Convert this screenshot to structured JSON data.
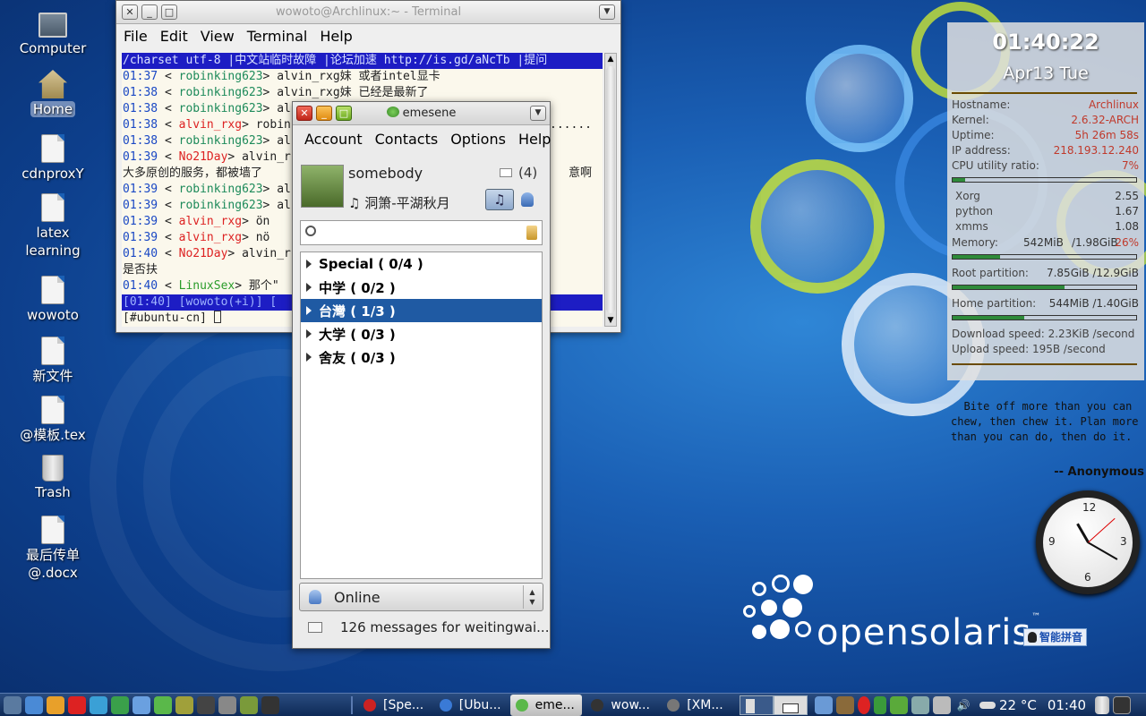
{
  "desktop": {
    "icons": [
      {
        "label": "Computer",
        "icon": "computer-icon"
      },
      {
        "label": "Home",
        "icon": "home-folder-icon"
      },
      {
        "label": "cdnproxY",
        "icon": "folder-icon"
      },
      {
        "label": "latex learning",
        "icon": "folder-icon"
      },
      {
        "label": "wowoto",
        "icon": "folder-icon"
      },
      {
        "label": "新文件",
        "icon": "text-file-icon"
      },
      {
        "label": "@模板.tex",
        "icon": "tex-file-icon"
      },
      {
        "label": "Trash",
        "icon": "trash-icon"
      },
      {
        "label": "最后传单@.docx",
        "icon": "docx-file-icon"
      }
    ]
  },
  "terminal": {
    "title": "wowoto@Archlinux:~ - Terminal",
    "menu": [
      "File",
      "Edit",
      "View",
      "Terminal",
      "Help"
    ],
    "topic": " /charset utf-8 |中文站临时故障 |论坛加速 http://is.gd/aNcTb |提问",
    "lines": [
      {
        "time": "01:37",
        "nick": "robinking623",
        "msg": "alvin_rxg妹 或者intel显卡",
        "color": "n1"
      },
      {
        "time": "01:38",
        "nick": "robinking623",
        "msg": "alvin_rxg妹 已经是最新了",
        "color": "n1"
      },
      {
        "time": "01:38",
        "nick": "robinking623",
        "msg": "al",
        "color": "n1"
      },
      {
        "time": "01:38",
        "nick": "alvin_rxg",
        "msg": "robin",
        "color": "n2",
        "tail": "了......"
      },
      {
        "time": "01:38",
        "nick": "robinking623",
        "msg": "al",
        "color": "n1"
      },
      {
        "time": "01:39",
        "nick": "No21Day",
        "msg": "alvin_r",
        "color": "n2"
      },
      {
        "time": "",
        "nick": "",
        "msg": "大多原创的服务，都被墙了",
        "color": "",
        "tail": "意啊"
      },
      {
        "time": "01:39",
        "nick": "robinking623",
        "msg": "al",
        "color": "n1"
      },
      {
        "time": "01:39",
        "nick": "robinking623",
        "msg": "al",
        "color": "n1"
      },
      {
        "time": "01:39",
        "nick": "alvin_rxg",
        "msg": "ön",
        "color": "n2"
      },
      {
        "time": "01:39",
        "nick": "alvin_rxg",
        "msg": "nö",
        "color": "n2"
      },
      {
        "time": "01:40",
        "nick": "No21Day",
        "msg": "alvin_r",
        "color": "n2"
      },
      {
        "time": "",
        "nick": "",
        "msg": "          是否扶",
        "color": ""
      },
      {
        "time": "01:40",
        "nick": "LinuxSex",
        "msg": "那个\"",
        "color": "n3"
      }
    ],
    "status": " [01:40] [wowoto(+i)] [",
    "input": "[#ubuntu-cn] "
  },
  "emesene": {
    "title": "emesene",
    "menu": [
      "Account",
      "Contacts",
      "Options",
      "Help"
    ],
    "nick": "somebody",
    "mail_count": "(4)",
    "personal_message": "♫ 洞箫-平湖秋月",
    "search_placeholder": "",
    "groups": [
      {
        "label": "Special ( 0/4 )",
        "selected": false
      },
      {
        "label": "中学 ( 0/2 )",
        "selected": false
      },
      {
        "label": "台灣 ( 1/3 )",
        "selected": true
      },
      {
        "label": "大学 ( 0/3 )",
        "selected": false
      },
      {
        "label": "舍友 ( 0/3 )",
        "selected": false
      }
    ],
    "status": "Online",
    "messages": "126 messages for weitingwai..."
  },
  "conky": {
    "time": "01:40:22",
    "date": "Apr13  Tue",
    "rows": [
      {
        "label": "Hostname:",
        "value": "Archlinux"
      },
      {
        "label": "Kernel:",
        "value": "2.6.32-ARCH"
      },
      {
        "label": "Uptime:",
        "value": "5h 26m 58s"
      },
      {
        "label": "IP address:",
        "value": "218.193.12.240"
      },
      {
        "label": "CPU utility ratio:",
        "value": "7%"
      }
    ],
    "cpu_fraction": 0.07,
    "processes": [
      {
        "name": "Xorg",
        "value": "2.55"
      },
      {
        "name": "python",
        "value": "1.67"
      },
      {
        "name": "xmms",
        "value": "1.08"
      }
    ],
    "memory": {
      "label": "Memory:",
      "used": "542MiB",
      "total": "/1.98GiB",
      "pct": "26%",
      "fraction": 0.26
    },
    "root": {
      "label": "Root partition:",
      "value": "7.85GiB /12.9GiB",
      "fraction": 0.61
    },
    "home": {
      "label": "Home  partition:",
      "value": "544MiB  /1.40GiB",
      "fraction": 0.39
    },
    "download": "Download speed: 2.23KiB /second",
    "upload": "Upload speed: 195B    /second"
  },
  "quote": {
    "text": "  Bite off more than you can chew, then chew it. Plan more than you can do, then do it.",
    "author": "-- Anonymous"
  },
  "wallpaper": {
    "brand": "opensolaris",
    "tm": "™",
    "ime": "智能拼音"
  },
  "taskbar": {
    "tasks": [
      {
        "label": "[Spe...",
        "active": false,
        "icon": "opera-icon"
      },
      {
        "label": "[Ubu...",
        "active": false,
        "icon": "firefox-icon"
      },
      {
        "label": "eme...",
        "active": true,
        "icon": "emesene-icon"
      },
      {
        "label": "wow...",
        "active": false,
        "icon": "terminal-icon"
      },
      {
        "label": "[XM...",
        "active": false,
        "icon": "xmms-icon"
      }
    ],
    "weather": "22 °C",
    "clock": "01:40",
    "quick_launch": [
      "computer-icon",
      "browser-icon",
      "cnet-icon",
      "opera-icon",
      "firefox-icon",
      "ie-icon",
      "contacts-icon",
      "chat-icon",
      "book-icon",
      "terminal-icon",
      "screenshot-icon",
      "editor-icon",
      "mms-icon"
    ]
  },
  "colors": {
    "selection": "#1f5aa3",
    "conky_value": "#c0392b",
    "bar": "#2e8b3a"
  }
}
